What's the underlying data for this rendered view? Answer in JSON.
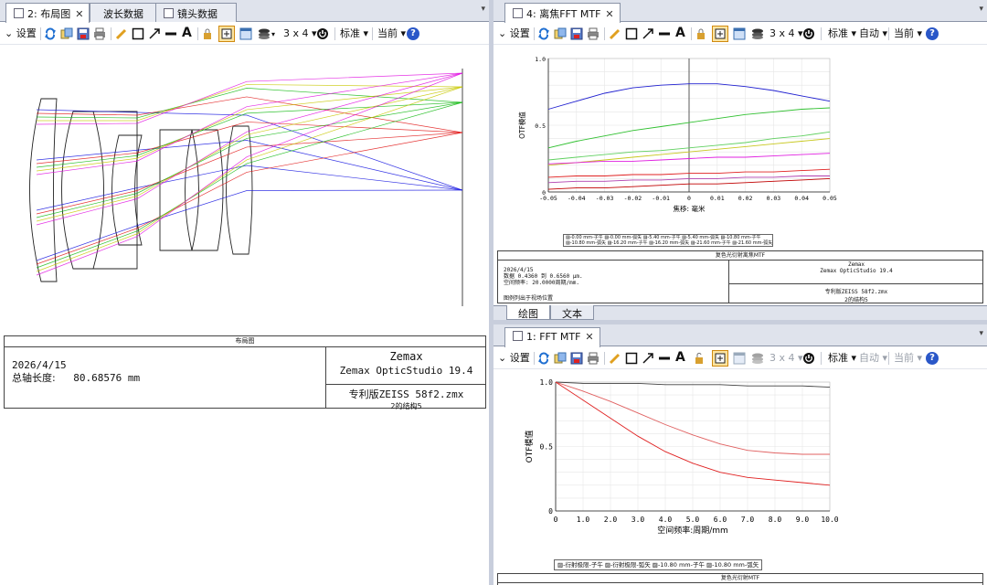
{
  "colors": {
    "accent": "#2a57c8",
    "rays_blue": "#1414e0",
    "rays_red": "#e01414",
    "rays_green": "#10b810",
    "rays_yellow": "#c8c800",
    "rays_magenta": "#e010e0"
  },
  "left_pane": {
    "tabs": [
      {
        "label": "2: 布局图",
        "active": true
      },
      {
        "label": "波长数据",
        "active": false
      },
      {
        "label": "镜头数据",
        "active": false
      }
    ],
    "toolbar": {
      "settings": "设置",
      "grid": "3 x 4",
      "standard": "标准",
      "current": "当前"
    },
    "layout_box": {
      "title": "布局图",
      "date": "2026/4/15",
      "axis_length_label": "总轴长度:",
      "axis_length_value": "80.68576 mm",
      "brand": "Zemax",
      "product": "Zemax OpticStudio 19.4",
      "file": "专利版ZEISS 58f2.zmx",
      "config": "2的结构5"
    }
  },
  "top_right_pane": {
    "tab": "4: 离焦FFT MTF",
    "toolbar": {
      "settings": "设置",
      "grid": "3 x 4",
      "standard": "标准",
      "auto": "自动",
      "current": "当前"
    },
    "chart": {
      "ylabel": "OTF模值",
      "xlabel": "焦移: 毫米",
      "xticks": [
        "-0.05",
        "-0.04",
        "-0.03",
        "-0.02",
        "-0.01",
        "0",
        "0.01",
        "0.02",
        "0.03",
        "0.04",
        "0.05"
      ],
      "yticks": [
        "1.0",
        "0.5",
        "0"
      ]
    },
    "legend_line1": "▨-0.00 mm-子午 ▨-0.00 mm-弧矢 ▨-5.40 mm-子午 ▨-5.40 mm-弧矢 ▨-10.80 mm-子午",
    "legend_line2": "▨-10.80 mm-弧矢 ▨-16.20 mm-子午 ▨-16.20 mm-弧矢 ▨-21.60 mm-子午 ▨-21.60 mm-弧矢",
    "box": {
      "title": "复色光衍射离焦MTF",
      "date": "2026/4/15",
      "line2": "数据 0.4360 到 0.6560 μm.",
      "line3": "空间频率: 20.0000周期/mm.",
      "line4": "图例列出于视场位置",
      "brand": "Zemax",
      "product": "Zemax OpticStudio 19.4",
      "file": "专利版ZEISS 58f2.zmx",
      "config": "2的结构5"
    },
    "bottom_tabs": [
      "绘图",
      "文本"
    ]
  },
  "bottom_right_pane": {
    "tab": "1: FFT MTF",
    "toolbar": {
      "settings": "设置",
      "grid": "3 x 4",
      "standard": "标准",
      "auto": "自动",
      "current": "当前"
    },
    "chart": {
      "ylabel": "OTF模值",
      "xlabel": "空间频率:周期/mm",
      "xticks": [
        "0",
        "1.0",
        "2.0",
        "3.0",
        "4.0",
        "5.0",
        "6.0",
        "7.0",
        "8.0",
        "9.0",
        "10.0"
      ],
      "yticks": [
        "1.0",
        "0.5",
        "0"
      ]
    },
    "legend": "▨-衍射极限-子午 ▨-衍射极限-弧矢 ▨-10.80 mm-子午 ▨-10.80 mm-弧矢",
    "box_title": "复色光衍射MTF"
  },
  "chart_data": [
    {
      "type": "line",
      "x": [
        -0.05,
        -0.04,
        -0.03,
        -0.02,
        -0.01,
        0,
        0.01,
        0.02,
        0.03,
        0.04,
        0.05
      ],
      "ylim": [
        0,
        1.0
      ],
      "xlim": [
        -0.05,
        0.05
      ],
      "xlabel": "焦移: 毫米",
      "ylabel": "OTF模值",
      "series": [
        {
          "color": "#2020d0",
          "values": [
            0.62,
            0.68,
            0.74,
            0.78,
            0.8,
            0.81,
            0.81,
            0.79,
            0.76,
            0.72,
            0.68
          ]
        },
        {
          "color": "#30c030",
          "values": [
            0.33,
            0.38,
            0.42,
            0.46,
            0.49,
            0.52,
            0.55,
            0.58,
            0.6,
            0.62,
            0.63
          ]
        },
        {
          "color": "#60d060",
          "values": [
            0.24,
            0.26,
            0.28,
            0.3,
            0.31,
            0.33,
            0.35,
            0.37,
            0.4,
            0.42,
            0.45
          ]
        },
        {
          "color": "#c8c820",
          "values": [
            0.2,
            0.22,
            0.24,
            0.26,
            0.28,
            0.3,
            0.32,
            0.34,
            0.36,
            0.38,
            0.4
          ]
        },
        {
          "color": "#e020e0",
          "values": [
            0.21,
            0.22,
            0.23,
            0.23,
            0.24,
            0.25,
            0.26,
            0.26,
            0.27,
            0.28,
            0.29
          ]
        },
        {
          "color": "#e02020",
          "values": [
            0.11,
            0.12,
            0.12,
            0.13,
            0.13,
            0.14,
            0.14,
            0.15,
            0.15,
            0.16,
            0.17
          ]
        },
        {
          "color": "#b040b0",
          "values": [
            0.07,
            0.08,
            0.08,
            0.09,
            0.09,
            0.1,
            0.1,
            0.11,
            0.11,
            0.12,
            0.12
          ]
        },
        {
          "color": "#c00000",
          "values": [
            0.02,
            0.03,
            0.03,
            0.04,
            0.05,
            0.06,
            0.06,
            0.07,
            0.08,
            0.09,
            0.1
          ]
        }
      ]
    },
    {
      "type": "line",
      "x": [
        0,
        1,
        2,
        3,
        4,
        5,
        6,
        7,
        8,
        9,
        10
      ],
      "ylim": [
        0,
        1.0
      ],
      "xlim": [
        0,
        10
      ],
      "xlabel": "空间频率:周期/mm",
      "ylabel": "OTF模值",
      "series": [
        {
          "color": "#404040",
          "values": [
            1.0,
            0.99,
            0.99,
            0.99,
            0.98,
            0.98,
            0.98,
            0.97,
            0.97,
            0.97,
            0.96
          ]
        },
        {
          "color": "#e06060",
          "values": [
            1.0,
            0.93,
            0.85,
            0.76,
            0.67,
            0.59,
            0.52,
            0.47,
            0.45,
            0.44,
            0.44
          ]
        },
        {
          "color": "#e02020",
          "values": [
            1.0,
            0.86,
            0.72,
            0.58,
            0.46,
            0.37,
            0.3,
            0.26,
            0.24,
            0.22,
            0.2
          ]
        }
      ]
    }
  ]
}
